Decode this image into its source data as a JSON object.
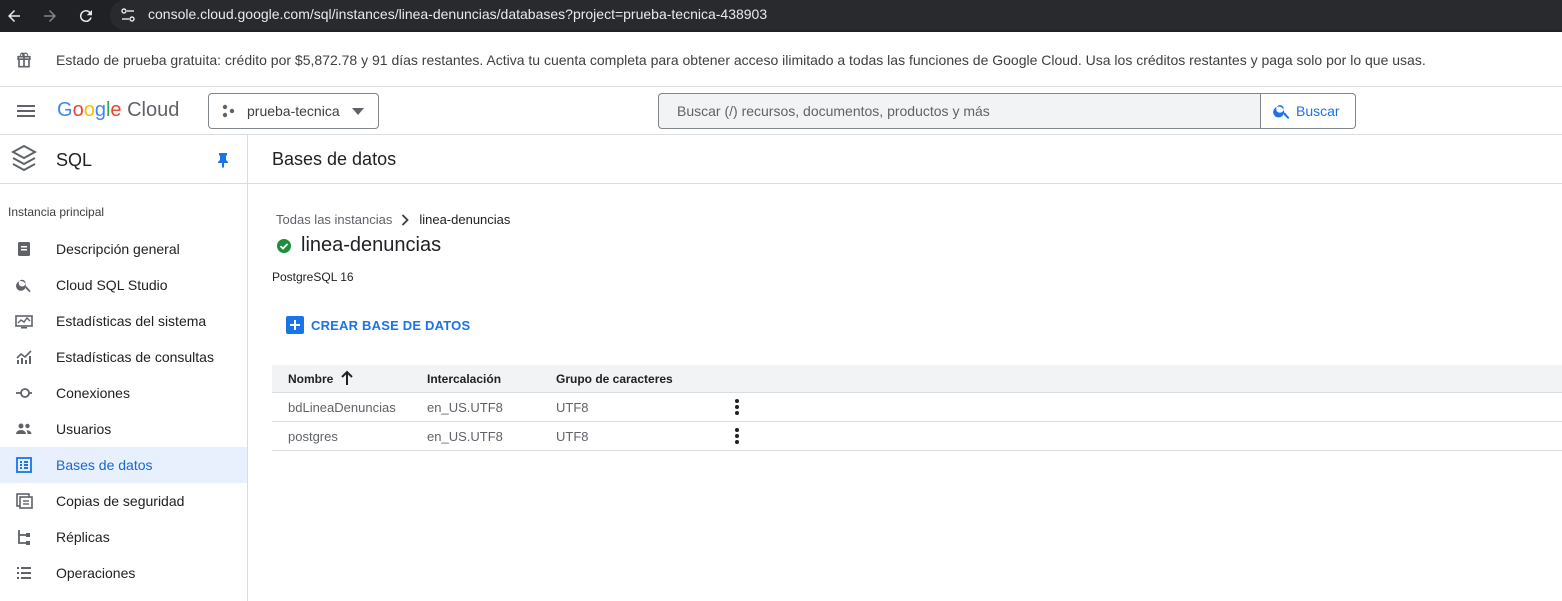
{
  "browser": {
    "url": "console.cloud.google.com/sql/instances/linea-denuncias/databases?project=prueba-tecnica-438903"
  },
  "banner": {
    "text": "Estado de prueba gratuita: crédito por $5,872.78 y 91 días restantes. Activa tu cuenta completa para obtener acceso ilimitado a todas las funciones de Google Cloud. Usa los créditos restantes y paga solo por lo que usas."
  },
  "header": {
    "logo": {
      "g1": "G",
      "g2": "o",
      "g3": "o",
      "g4": "g",
      "g5": "l",
      "g6": "e",
      "cloud": "Cloud"
    },
    "project": "prueba-tecnica",
    "search_placeholder": "Buscar (/) recursos, documentos, productos y más",
    "search_button": "Buscar"
  },
  "sidebar": {
    "title": "SQL",
    "section": "Instancia principal",
    "items": [
      {
        "label": "Descripción general",
        "icon": "overview-icon"
      },
      {
        "label": "Cloud SQL Studio",
        "icon": "search-icon"
      },
      {
        "label": "Estadísticas del sistema",
        "icon": "monitor-icon"
      },
      {
        "label": "Estadísticas de consultas",
        "icon": "chart-icon"
      },
      {
        "label": "Conexiones",
        "icon": "connections-icon"
      },
      {
        "label": "Usuarios",
        "icon": "users-icon"
      },
      {
        "label": "Bases de datos",
        "icon": "databases-icon",
        "active": true
      },
      {
        "label": "Copias de seguridad",
        "icon": "backup-icon"
      },
      {
        "label": "Réplicas",
        "icon": "replicas-icon"
      },
      {
        "label": "Operaciones",
        "icon": "list-icon"
      }
    ]
  },
  "main": {
    "title": "Bases de datos",
    "breadcrumb": {
      "parent": "Todas las instancias",
      "current": "linea-denuncias"
    },
    "instance_name": "linea-denuncias",
    "db_version": "PostgreSQL 16",
    "create_button": "CREAR BASE DE DATOS",
    "table": {
      "headers": [
        "Nombre",
        "Intercalación",
        "Grupo de caracteres"
      ],
      "rows": [
        [
          "bdLineaDenuncias",
          "en_US.UTF8",
          "UTF8"
        ],
        [
          "postgres",
          "en_US.UTF8",
          "UTF8"
        ]
      ]
    }
  },
  "colors": {
    "accent": "#1a73e8",
    "active_bg": "#e8f0fe",
    "success": "#1e8e3e",
    "browser_bar": "#202124"
  }
}
